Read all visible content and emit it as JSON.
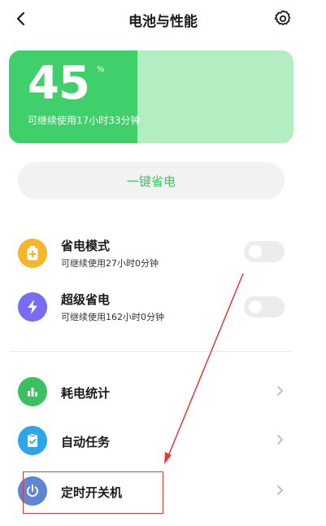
{
  "header": {
    "title": "电池与性能"
  },
  "battery": {
    "percent": "45",
    "unit": "%",
    "level_percent": 45,
    "remaining": "可继续使用17小时33分钟"
  },
  "one_key": {
    "label": "一键省电"
  },
  "modes": [
    {
      "title": "省电模式",
      "subtitle": "可继续使用27小时0分钟",
      "enabled": false
    },
    {
      "title": "超级省电",
      "subtitle": "可继续使用162小时0分钟",
      "enabled": false
    }
  ],
  "menu": [
    {
      "label": "耗电统计"
    },
    {
      "label": "自动任务"
    },
    {
      "label": "定时开关机"
    }
  ],
  "icons": {
    "back": "chevron-left-icon",
    "settings": "gear-icon",
    "power_save": "battery-plus-icon",
    "super_save": "lightning-icon",
    "stats": "bar-chart-icon",
    "auto_task": "clipboard-check-icon",
    "timer_power": "power-icon"
  },
  "colors": {
    "battery_fill": "#3fcf6b",
    "battery_track": "#b3eec3",
    "one_key_text": "#3ec66a",
    "icon_power_save": "#f7b529",
    "icon_super_save": "#7a6cf0",
    "icon_stats": "#39c15f",
    "icon_auto_task": "#2ca6e8",
    "icon_timer_power": "#5f86d6",
    "annotation": "#e53935"
  }
}
